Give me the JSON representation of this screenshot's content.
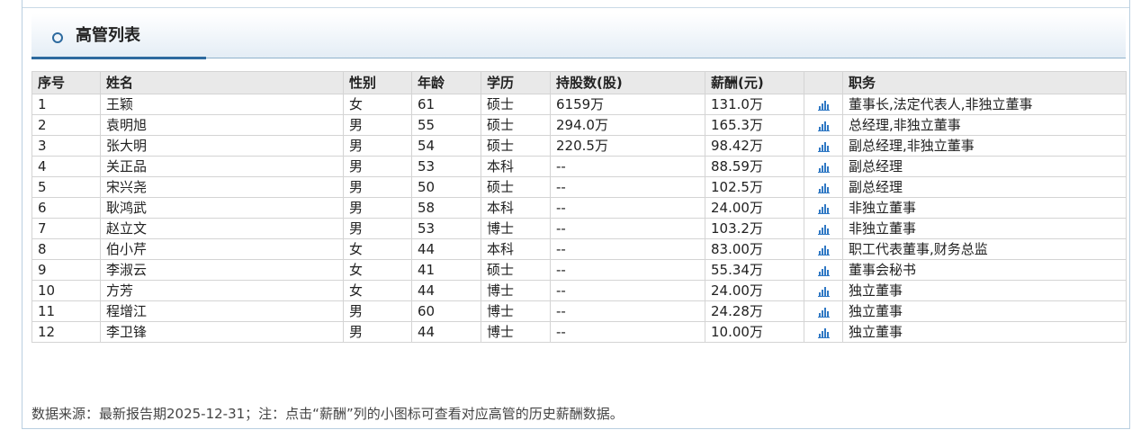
{
  "section": {
    "title": "高管列表",
    "icon": "circle-icon"
  },
  "table": {
    "columns": [
      "序号",
      "姓名",
      "性别",
      "年龄",
      "学历",
      "持股数(股)",
      "薪酬(元)",
      "",
      "职务"
    ],
    "rows": [
      [
        "1",
        "王颖",
        "女",
        "61",
        "硕士",
        "6159万",
        "131.0万",
        "bar-chart-icon",
        "董事长,法定代表人,非独立董事"
      ],
      [
        "2",
        "袁明旭",
        "男",
        "55",
        "硕士",
        "294.0万",
        "165.3万",
        "bar-chart-icon",
        "总经理,非独立董事"
      ],
      [
        "3",
        "张大明",
        "男",
        "54",
        "硕士",
        "220.5万",
        "98.42万",
        "bar-chart-icon",
        "副总经理,非独立董事"
      ],
      [
        "4",
        "关正品",
        "男",
        "53",
        "本科",
        "--",
        "88.59万",
        "bar-chart-icon",
        "副总经理"
      ],
      [
        "5",
        "宋兴尧",
        "男",
        "50",
        "硕士",
        "--",
        "102.5万",
        "bar-chart-icon",
        "副总经理"
      ],
      [
        "6",
        "耿鸿武",
        "男",
        "58",
        "本科",
        "--",
        "24.00万",
        "bar-chart-icon",
        "非独立董事"
      ],
      [
        "7",
        "赵立文",
        "男",
        "53",
        "博士",
        "--",
        "103.2万",
        "bar-chart-icon",
        "非独立董事"
      ],
      [
        "8",
        "伯小芹",
        "女",
        "44",
        "本科",
        "--",
        "83.00万",
        "bar-chart-icon",
        "职工代表董事,财务总监"
      ],
      [
        "9",
        "李淑云",
        "女",
        "41",
        "硕士",
        "--",
        "55.34万",
        "bar-chart-icon",
        "董事会秘书"
      ],
      [
        "10",
        "方芳",
        "女",
        "44",
        "博士",
        "--",
        "24.00万",
        "bar-chart-icon",
        "独立董事"
      ],
      [
        "11",
        "程增江",
        "男",
        "60",
        "博士",
        "--",
        "24.28万",
        "bar-chart-icon",
        "独立董事"
      ],
      [
        "12",
        "李卫锋",
        "男",
        "44",
        "博士",
        "--",
        "10.00万",
        "bar-chart-icon",
        "独立董事"
      ]
    ]
  },
  "footnote": "数据来源：最新报告期2025-12-31；注：点击“薪酬”列的小图标可查看对应高管的历史薪酬数据。",
  "colors": {
    "accent": "#2d6a9f",
    "icon": "#2f78c4",
    "header_bg": "#e9e9e9",
    "border": "#d4d4d4"
  }
}
